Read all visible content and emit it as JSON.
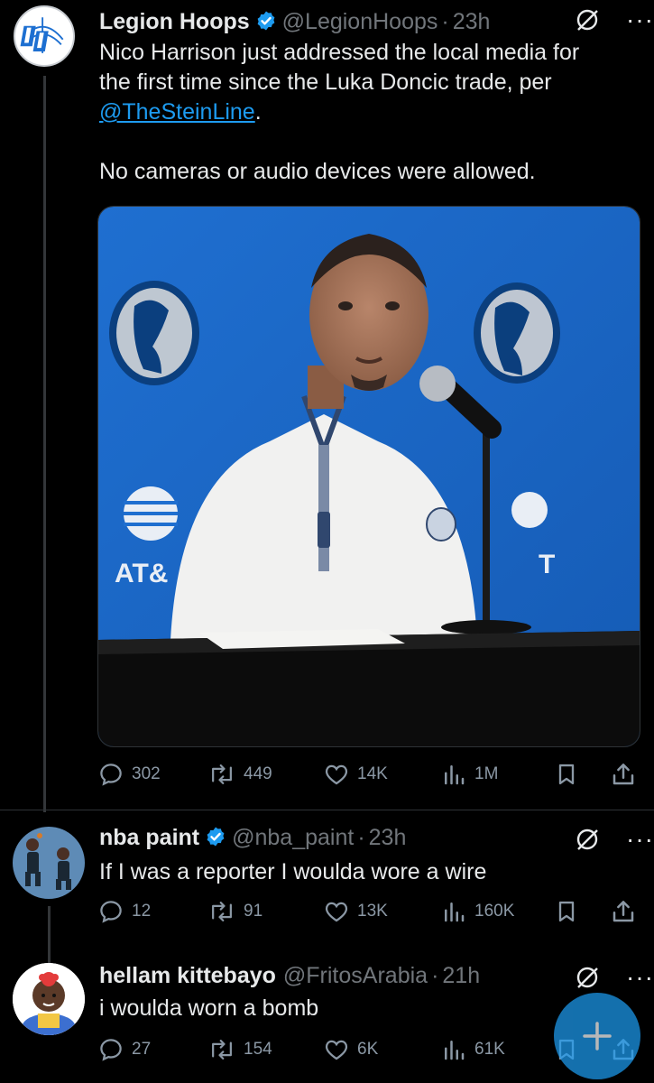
{
  "tweets": [
    {
      "name": "Legion Hoops",
      "handle": "@LegionHoops",
      "time": "23h",
      "text_line1": "Nico Harrison just addressed the local media for",
      "text_line2": "the first time since the Luka Doncic trade, per",
      "mention": "@TheSteinLine",
      "mention_suffix": ".",
      "text_line4": "No cameras or audio devices were allowed.",
      "avatar_text": "LH",
      "media_sign_left": "AT&",
      "media_sign_right": "T",
      "replies": "302",
      "reposts": "449",
      "likes": "14K",
      "views": "1M"
    },
    {
      "name": "nba paint",
      "handle": "@nba_paint",
      "time": "23h",
      "text": "If I was a reporter I woulda wore a wire",
      "replies": "12",
      "reposts": "91",
      "likes": "13K",
      "views": "160K"
    },
    {
      "name": "hellam kittebayo",
      "handle": "@FritosArabia",
      "time": "21h",
      "text": "i woulda worn a bomb",
      "replies": "27",
      "reposts": "154",
      "likes": "6K",
      "views": "61K"
    }
  ],
  "separator": "·",
  "more_glyph": "···",
  "fab_glyph": "+",
  "colors": {
    "accent": "#1d9bf0",
    "muted": "#71767b",
    "background": "#000000",
    "text": "#e7e9ea"
  }
}
